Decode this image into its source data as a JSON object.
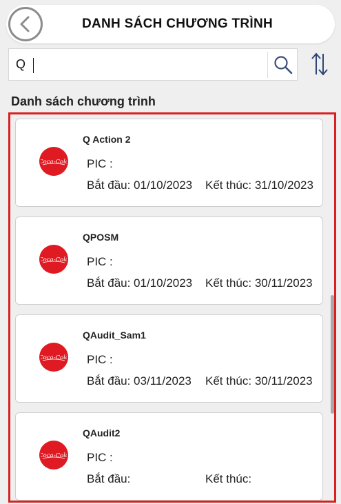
{
  "header": {
    "title": "DANH SÁCH CHƯƠNG TRÌNH",
    "back_icon": "chevron-left-icon"
  },
  "search": {
    "value": "Q",
    "placeholder": "",
    "search_icon": "search-icon",
    "sort_icon": "sort-arrows-icon"
  },
  "section": {
    "title": "Danh sách chương trình"
  },
  "colors": {
    "highlight_border": "#d9201f",
    "logo_red": "#e01a22"
  },
  "programs": [
    {
      "name": "Q Action 2",
      "pic_label": "PIC :",
      "start_label": "Bắt đầu: 01/10/2023",
      "end_label": "Kết thúc: 31/10/2023",
      "logo_text": "Coca-Cola"
    },
    {
      "name": "QPOSM",
      "pic_label": "PIC :",
      "start_label": "Bắt đầu: 01/10/2023",
      "end_label": "Kết thúc: 30/11/2023",
      "logo_text": "Coca-Cola"
    },
    {
      "name": "QAudit_Sam1",
      "pic_label": "PIC :",
      "start_label": "Bắt đầu: 03/11/2023",
      "end_label": "Kết thúc: 30/11/2023",
      "logo_text": "Coca-Cola"
    },
    {
      "name": "QAudit2",
      "pic_label": "PIC :",
      "start_label": "Bắt đầu:",
      "end_label": "Kết thúc:",
      "logo_text": "Coca-Cola"
    }
  ]
}
